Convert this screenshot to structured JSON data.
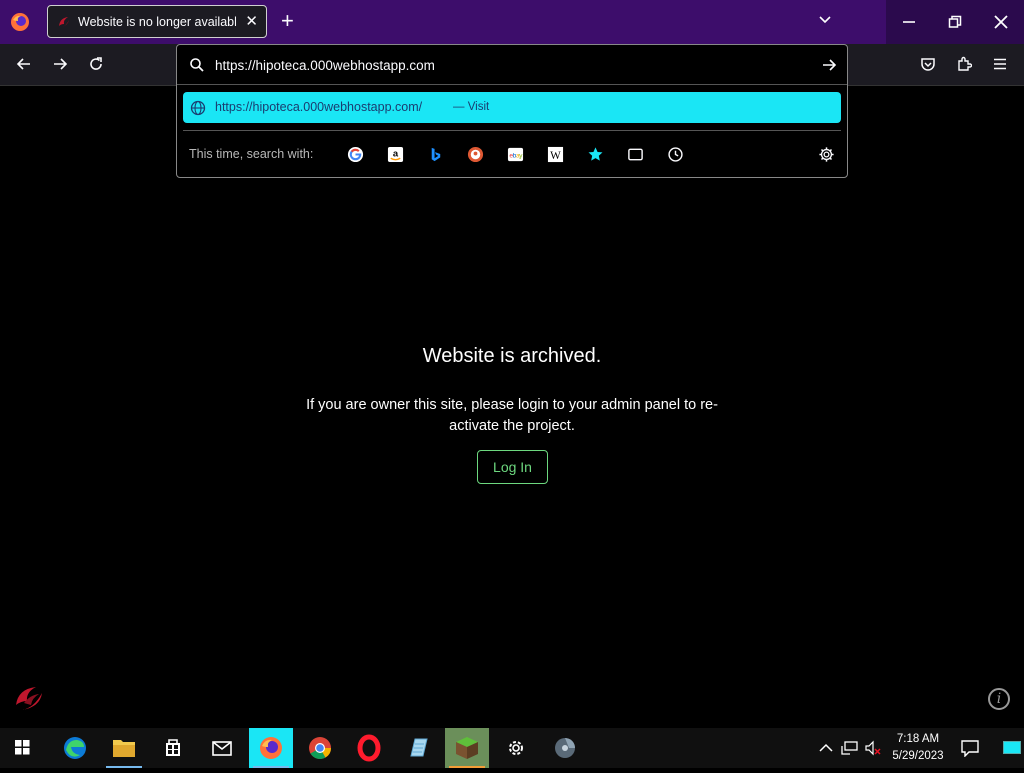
{
  "browser": {
    "tab_title": "Website is no longer available |",
    "new_tab": "+",
    "close_tab": "✕"
  },
  "url_bar": {
    "value": "https://hipoteca.000webhostapp.com",
    "suggestion_url": "https://hipoteca.000webhostapp.com/",
    "suggestion_action": "— Visit",
    "search_with_label": "This time, search with:",
    "engines": [
      "Google",
      "Amazon",
      "Bing",
      "DuckDuckGo",
      "eBay",
      "Wikipedia",
      "Bookmarks",
      "Tabs",
      "History"
    ]
  },
  "page": {
    "heading": "Website is archived.",
    "message": "If you are owner this site, please login to your admin panel to re-activate the project.",
    "login_button": "Log In"
  },
  "taskbar": {
    "time": "7:18 AM",
    "date": "5/29/2023"
  },
  "colors": {
    "titlebar": "#3d0d6b",
    "suggestion_highlight": "#1ae6f5",
    "login_accent": "#6dd87f"
  }
}
